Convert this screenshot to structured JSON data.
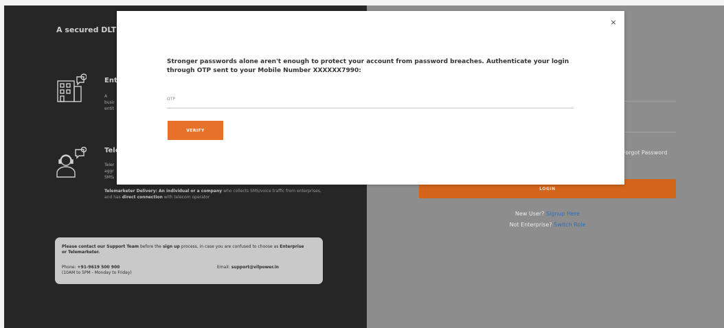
{
  "left_panel": {
    "headline": "A secured DLT platform for commercial communication",
    "enterprise": {
      "title": "Enterprise",
      "desc": "A business entity who sends commercial messages to its customers"
    },
    "telemarketer": {
      "title": "Telemarketer",
      "desc": "Telemarketer aggregator: SMS/voice traffic from enterprises via telecom operator",
      "delivery_label": "Telemarketer Delivery:",
      "delivery_text_1": "An individual or a company",
      "delivery_text_2": "who collects SMS/voice traffic from enterprises, and has",
      "delivery_text_3": "direct connection",
      "delivery_text_4": "with telecom operator"
    },
    "support": {
      "p1": "Please contact our Support Team",
      "p2": "before the",
      "p3": "sign up",
      "p4": "process, in case you are confused",
      "p5": "to choose as",
      "p6": "Enterprise or Telemarketer.",
      "phone_label": "Phone:",
      "phone": "+91-9619 500 900",
      "hours": "(10AM to 5PM - Monday to Friday)",
      "email_label": "Email:",
      "email": "support@vilpower.in"
    }
  },
  "right_panel": {
    "forgot_password": "Forgot Password",
    "login_button": "LOGIN",
    "new_user": "New User?",
    "signup_link": "Signup Here",
    "not_enterprise": "Not Enterprise?",
    "switch_role": "Switch Role"
  },
  "modal": {
    "close_glyph": "×",
    "message": "Stronger passwords alone aren't enough to protect your account from password breaches. Authenticate your login through OTP sent to your Mobile Number XXXXXX7990:",
    "otp_label": "OTP",
    "otp_value": "",
    "verify_button": "VERIFY"
  },
  "colors": {
    "accent": "#e8712a",
    "login": "#d3651a",
    "dark_panel": "#262626",
    "grey_panel": "#8d8d8d",
    "link": "#2f6fb7"
  }
}
